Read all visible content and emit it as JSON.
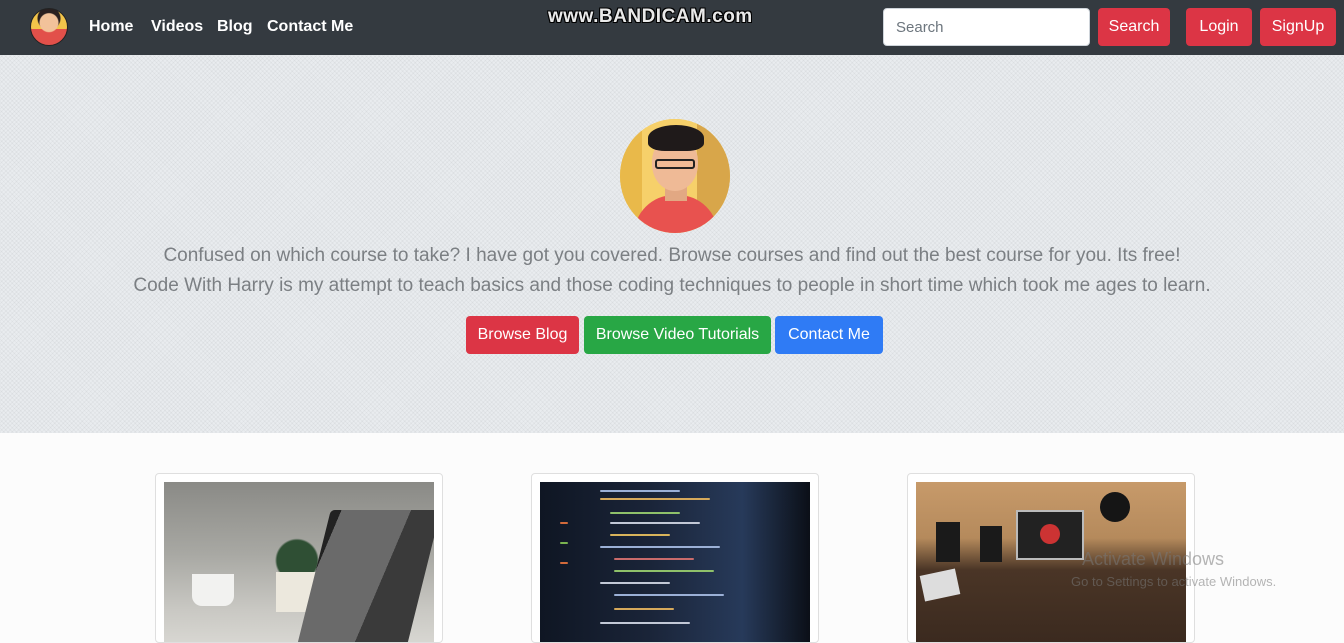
{
  "nav": {
    "links": [
      "Home",
      "Videos",
      "Blog",
      "Contact Me"
    ],
    "search_placeholder": "Search",
    "search_button": "Search",
    "login_button": "Login",
    "signup_button": "SignUp"
  },
  "watermark": "www.BANDICAM.com",
  "hero": {
    "line1": "Confused on which course to take? I have got you covered. Browse courses and find out the best course for you. Its free!",
    "line2": "Code With Harry is my attempt to teach basics and those coding techniques to people in short time which took me ages to learn.",
    "buttons": [
      "Browse Blog",
      "Browse Video Tutorials",
      "Contact Me"
    ]
  },
  "cards": [
    {
      "image": "laptop-coffee-plant"
    },
    {
      "image": "code-on-screen"
    },
    {
      "image": "desk-workspace"
    }
  ],
  "os_overlay": {
    "line1": "Activate Windows",
    "line2": "Go to Settings to activate Windows."
  },
  "colors": {
    "navbar": "#343a40",
    "red": "#dc3545",
    "green": "#28a745",
    "blue": "#2f7bf5"
  }
}
